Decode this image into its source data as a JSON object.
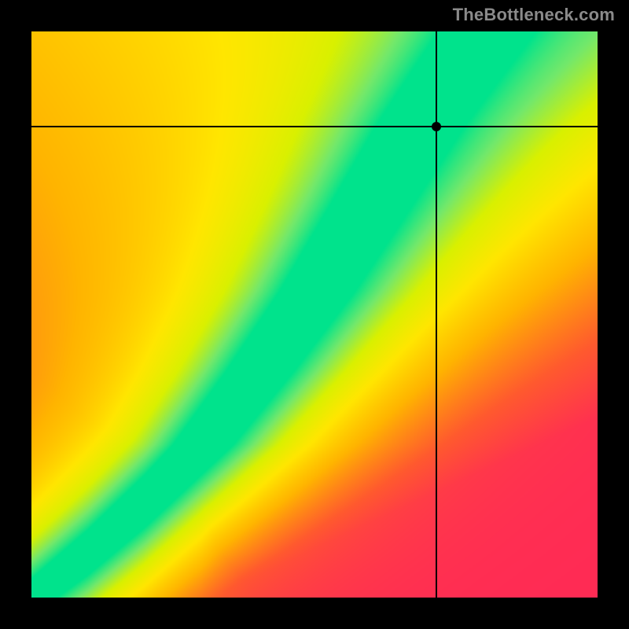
{
  "attribution": "TheBottleneck.com",
  "chart_data": {
    "type": "heatmap",
    "title": "",
    "xlabel": "",
    "ylabel": "",
    "xlim": [
      0,
      1
    ],
    "ylim": [
      0,
      1
    ],
    "color_scale": {
      "stops": [
        {
          "t": 0.0,
          "color": "#ff2a55"
        },
        {
          "t": 0.18,
          "color": "#ff5a2e"
        },
        {
          "t": 0.38,
          "color": "#ffb400"
        },
        {
          "t": 0.55,
          "color": "#ffe600"
        },
        {
          "t": 0.7,
          "color": "#d9f000"
        },
        {
          "t": 0.85,
          "color": "#74e86a"
        },
        {
          "t": 1.0,
          "color": "#00e38c"
        }
      ],
      "note": "t is closeness-to-ridge (1 = on ridge, 0 = far). Ridge is curved green band; surrounding field fades through yellow/orange to red."
    },
    "ridge_curve_y_of_x": [
      {
        "x": 0.0,
        "y": 0.0
      },
      {
        "x": 0.1,
        "y": 0.08
      },
      {
        "x": 0.2,
        "y": 0.17
      },
      {
        "x": 0.3,
        "y": 0.27
      },
      {
        "x": 0.4,
        "y": 0.4
      },
      {
        "x": 0.5,
        "y": 0.54
      },
      {
        "x": 0.6,
        "y": 0.7
      },
      {
        "x": 0.68,
        "y": 0.83
      },
      {
        "x": 0.75,
        "y": 0.93
      },
      {
        "x": 0.8,
        "y": 1.0
      }
    ],
    "ridge_half_width_normalized": 0.055,
    "crosshair": {
      "x": 0.715,
      "y": 0.832
    },
    "annotations": []
  }
}
